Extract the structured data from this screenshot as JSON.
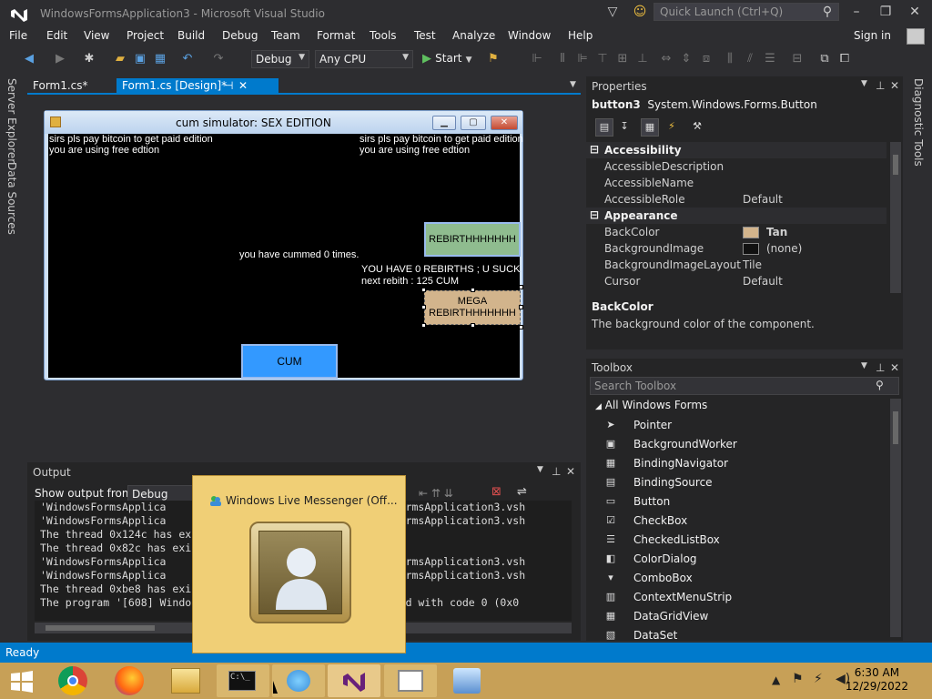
{
  "window": {
    "title": "WindowsFormsApplication3 - Microsoft Visual Studio"
  },
  "search": {
    "placeholder": "Quick Launch (Ctrl+Q)"
  },
  "menu": [
    "File",
    "Edit",
    "View",
    "Project",
    "Build",
    "Debug",
    "Team",
    "Format",
    "Tools",
    "Test",
    "Analyze",
    "Window",
    "Help"
  ],
  "signin": "Sign in",
  "toolbar": {
    "config": "Debug",
    "platform": "Any CPU",
    "start": "Start"
  },
  "tabs": [
    {
      "label": "Form1.cs*"
    },
    {
      "label": "Form1.cs [Design]*"
    }
  ],
  "left_sidebar": [
    "Server Explorer",
    "Data Sources"
  ],
  "form": {
    "title": "cum simulator: SEX EDITION",
    "label_pay1": "sirs pls pay bitcoin to  get paid edition",
    "label_free1": "you are using free edtion",
    "label_pay2": "sirs pls pay bitcoin to  get paid edition",
    "label_free2": "you are using free edtion",
    "label_count": "you have cummed 0 times.",
    "label_rebirths": "YOU HAVE  0 REBIRTHS ; U SUCK",
    "label_next": "next rebith : 125 CUM",
    "btn_rebirth": "REBIRTHHHHHHH",
    "btn_mega1": "MEGA",
    "btn_mega2": "REBIRTHHHHHHH",
    "btn_cum": "CUM"
  },
  "output": {
    "title": "Output",
    "source_label": "Show output from:",
    "source_value": "Debug",
    "lines": [
      "'WindowsFormsApplica                              indowsFormsApplication3.vsh",
      "'WindowsFormsApplica                              indowsFormsApplication3.vsh",
      "The thread 0x124c has exi",
      "The thread 0x82c has exi",
      "'WindowsFormsApplica                              indowsFormsApplication3.vsh",
      "'WindowsFormsApplica                              indowsFormsApplication3.vsh",
      "The thread 0xbe8 has exi",
      "The program '[608] Windo                          as exited with code 0 (0x0"
    ]
  },
  "properties": {
    "title": "Properties",
    "object_name": "button3",
    "object_type": "System.Windows.Forms.Button",
    "rows": [
      {
        "cat": "Accessibility"
      },
      {
        "name": "AccessibleDescription",
        "value": ""
      },
      {
        "name": "AccessibleName",
        "value": ""
      },
      {
        "name": "AccessibleRole",
        "value": "Default"
      },
      {
        "cat": "Appearance"
      },
      {
        "name": "BackColor",
        "value": "Tan",
        "swatch": "#d2b48c"
      },
      {
        "name": "BackgroundImage",
        "value": "(none)",
        "swatch": "#111111"
      },
      {
        "name": "BackgroundImageLayout",
        "value": "Tile"
      },
      {
        "name": "Cursor",
        "value": "Default"
      }
    ],
    "desc_title": "BackColor",
    "desc_text": "The background color of the component."
  },
  "toolbox": {
    "title": "Toolbox",
    "search_placeholder": "Search Toolbox",
    "group": "All Windows Forms",
    "items": [
      {
        "label": "Pointer",
        "icon": "pointer-icon",
        "glyph": "➤"
      },
      {
        "label": "BackgroundWorker",
        "icon": "background-worker-icon",
        "glyph": "▣"
      },
      {
        "label": "BindingNavigator",
        "icon": "binding-navigator-icon",
        "glyph": "▦"
      },
      {
        "label": "BindingSource",
        "icon": "binding-source-icon",
        "glyph": "▤"
      },
      {
        "label": "Button",
        "icon": "button-icon",
        "glyph": "▭"
      },
      {
        "label": "CheckBox",
        "icon": "checkbox-icon",
        "glyph": "☑"
      },
      {
        "label": "CheckedListBox",
        "icon": "checked-listbox-icon",
        "glyph": "☰"
      },
      {
        "label": "ColorDialog",
        "icon": "color-dialog-icon",
        "glyph": "◧"
      },
      {
        "label": "ComboBox",
        "icon": "combobox-icon",
        "glyph": "▾"
      },
      {
        "label": "ContextMenuStrip",
        "icon": "context-menu-icon",
        "glyph": "▥"
      },
      {
        "label": "DataGridView",
        "icon": "datagrid-icon",
        "glyph": "▦"
      },
      {
        "label": "DataSet",
        "icon": "dataset-icon",
        "glyph": "▧"
      }
    ]
  },
  "diagnostic": "Diagnostic Tools",
  "status": "Ready",
  "messenger": {
    "title": "Windows Live Messenger (Off..."
  },
  "clock": {
    "time": "6:30 AM",
    "date": "12/29/2022"
  },
  "colors": {
    "accent": "#007acc",
    "taskbar": "#c7a057",
    "rebirth_button": "#8fbc8f",
    "mega_button": "#d2b48c",
    "cum_button": "#3399ff"
  }
}
